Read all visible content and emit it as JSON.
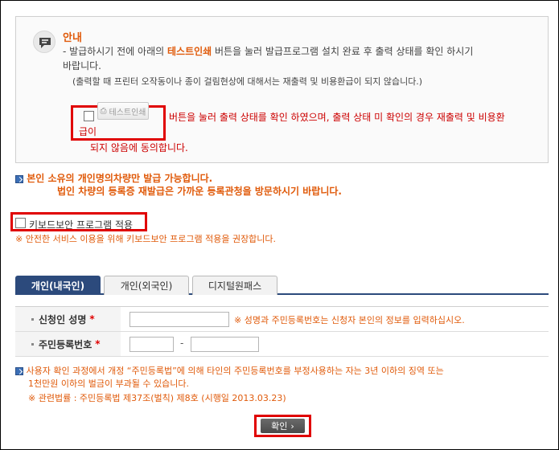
{
  "notice": {
    "title": "안내",
    "line1_prefix": "- 발급하시기 전에 아래의 ",
    "line1_highlight": "테스트인쇄",
    "line1_suffix": " 버튼을 눌러 발급프로그램 설치 완료 후 출력 상태를 확인 하시기",
    "line2": "바랍니다.",
    "line3": "(출력할 때 프린터 오작동이나 종이 걸림현상에 대해서는 재출력 및 비용환급이 되지 않습니다.)",
    "test_print_label": "테스트인쇄",
    "agree_line1": "버튼을 눌러 출력 상태를 확인 하였으며, 출력 상태 미 확인의 경우 재출력 및 비용환",
    "agree_line2": "급이",
    "agree_line3": "되지 않음에 동의합니다."
  },
  "owner_notice": {
    "line1": "본인 소유의 개인명의차량만 발급 가능합니다.",
    "line2": "법인 차량의 등록증 재발급은 가까운 등록관청을 방문하시기 바랍니다."
  },
  "keyboard_security": {
    "label": "키보드보안 프로그램 적용",
    "note": "※ 안전한 서비스 이용을 위해 키보드보안 프로그램 적용을 권장합니다."
  },
  "tabs": [
    {
      "label": "개인(내국인)",
      "active": true
    },
    {
      "label": "개인(외국인)",
      "active": false
    },
    {
      "label": "디지털원패스",
      "active": false
    }
  ],
  "form": {
    "name_label": "신청인 성명",
    "rrn_label": "주민등록번호",
    "required_mark": "*",
    "name_hint": "※ 성명과 주민등록번호는 신청자 본인의 정보를 입력하십시오.",
    "name_value": "",
    "rrn_front_value": "",
    "rrn_back_value": "",
    "dash": "-"
  },
  "legal": {
    "line1": "사용자 확인 과정에서 개정 “주민등록법”에 의해 타인의 주민등록번호를 부정사용하는 자는 3년 이하의 징역 또는",
    "line2": "1천만원 이하의 벌금이 부과될 수 있습니다.",
    "line3": "※ 관련법률 : 주민등록법 제37조(벌칙) 제8호 (시행일 2013.03.23)"
  },
  "confirm_label": "확인",
  "colors": {
    "accent": "#e05a0a",
    "highlight_box": "#e00000",
    "tab_active": "#2c4a7c"
  }
}
